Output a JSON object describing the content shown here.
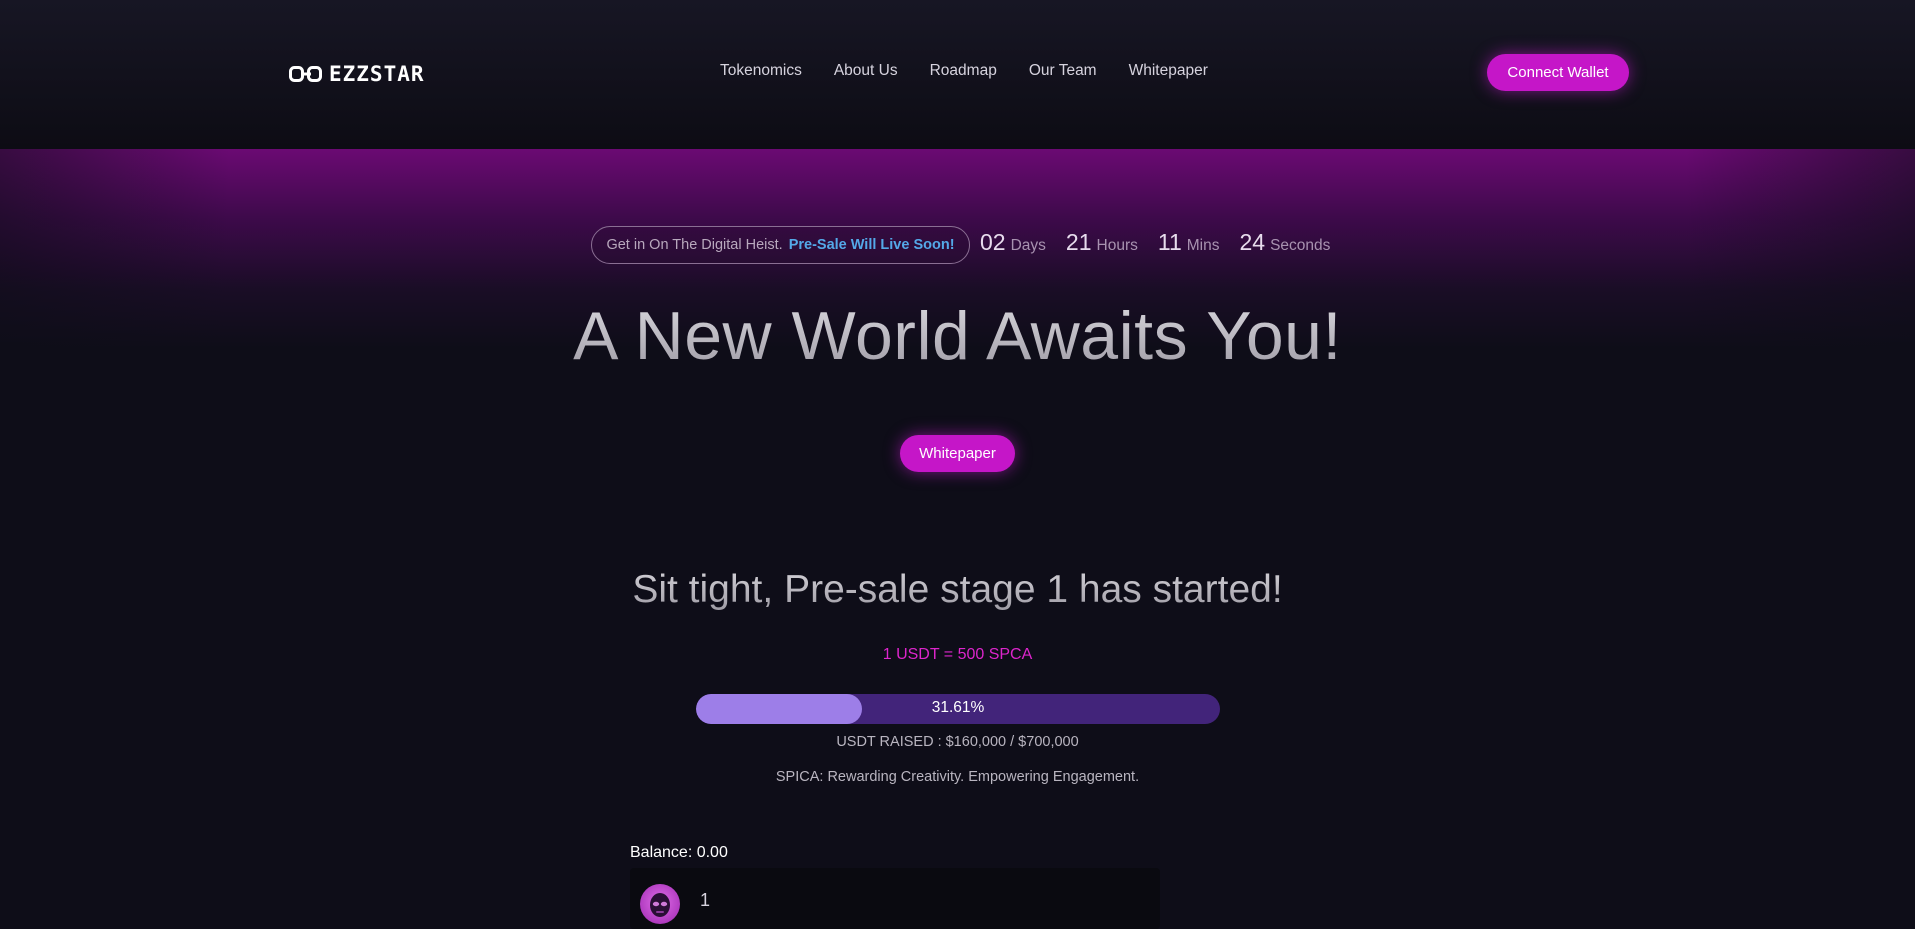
{
  "brand": {
    "name": "EZZSTAR",
    "logo_icon": "linked-rings-icon"
  },
  "nav": {
    "items": [
      {
        "label": "Tokenomics"
      },
      {
        "label": "About Us"
      },
      {
        "label": "Roadmap"
      },
      {
        "label": "Our Team"
      },
      {
        "label": "Whitepaper"
      }
    ]
  },
  "header": {
    "connect_label": "Connect Wallet"
  },
  "notice": {
    "text": "Get in On The Digital Heist.",
    "highlight": "Pre-Sale Will Live Soon!"
  },
  "countdown": {
    "days": "02",
    "days_label": "Days",
    "hours": "21",
    "hours_label": "Hours",
    "mins": "11",
    "mins_label": "Mins",
    "seconds": "24",
    "seconds_label": "Seconds"
  },
  "hero": {
    "title": "A New World Awaits You!",
    "button_label": "Whitepaper"
  },
  "presale": {
    "stage_title": "Sit tight, Pre-sale stage 1 has started!",
    "rate": "1 USDT = 500 SPCA",
    "progress_percent": 31.61,
    "progress_label": "31.61%",
    "raised": "USDT RAISED : $160,000 / $700,000",
    "tagline": "SPICA: Rewarding Creativity. Empowering Engagement.",
    "balance": "Balance: 0.00",
    "amount": "1",
    "token_icon": "alien-avatar-icon"
  },
  "colors": {
    "accent": "#c516c8",
    "highlight_blue": "#54a8e8",
    "rate_pink": "#dd25cc",
    "progress_fill": "#9d7ee8",
    "progress_track": "#42247a",
    "background": "#0e0d18"
  }
}
